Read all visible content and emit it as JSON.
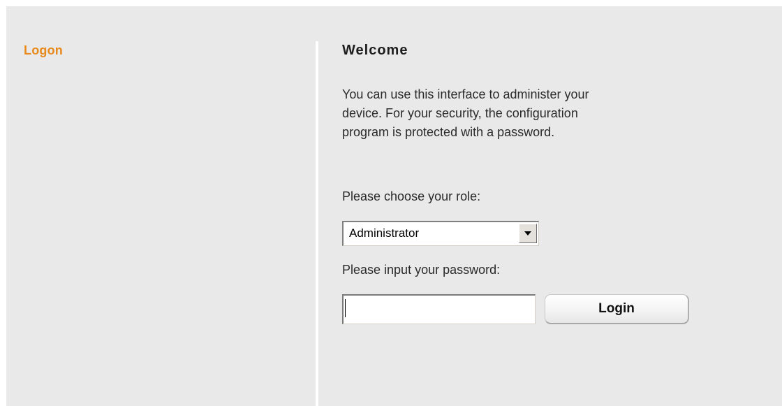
{
  "sidebar": {
    "items": [
      {
        "label": "Logon"
      }
    ]
  },
  "main": {
    "title": "Welcome",
    "intro_lines": [
      "You can use this interface to administer your",
      "device. For your security, the configuration",
      "program is protected with a password."
    ],
    "role_label": "Please choose your role:",
    "role_select": {
      "value": "Administrator"
    },
    "password_label": "Please input your password:",
    "password_input": {
      "value": ""
    },
    "login_label": "Login"
  },
  "colors": {
    "background": "#e9e9e9",
    "sidebar_link": "#e8891c",
    "divider": "#ffffff"
  },
  "icons": {
    "dropdown": "chevron-down-icon"
  }
}
